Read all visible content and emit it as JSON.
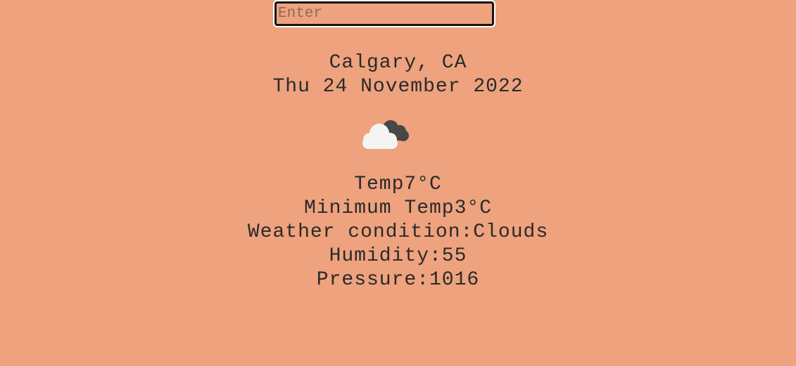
{
  "search": {
    "placeholder": "Enter"
  },
  "location": {
    "city": "Calgary, CA",
    "date": "Thu 24 November 2022"
  },
  "weather_icon": {
    "name": "cloud-icon",
    "front_color": "#f4f4f4",
    "back_color": "#474747"
  },
  "stats": {
    "temp": "Temp7°C",
    "min_temp": "Minimum Temp3°C",
    "condition": "Weather condition:Clouds",
    "humidity": "Humidity:55",
    "pressure": "Pressure:1016"
  },
  "colors": {
    "background": "#eea27e",
    "text": "#2a2a2a"
  }
}
